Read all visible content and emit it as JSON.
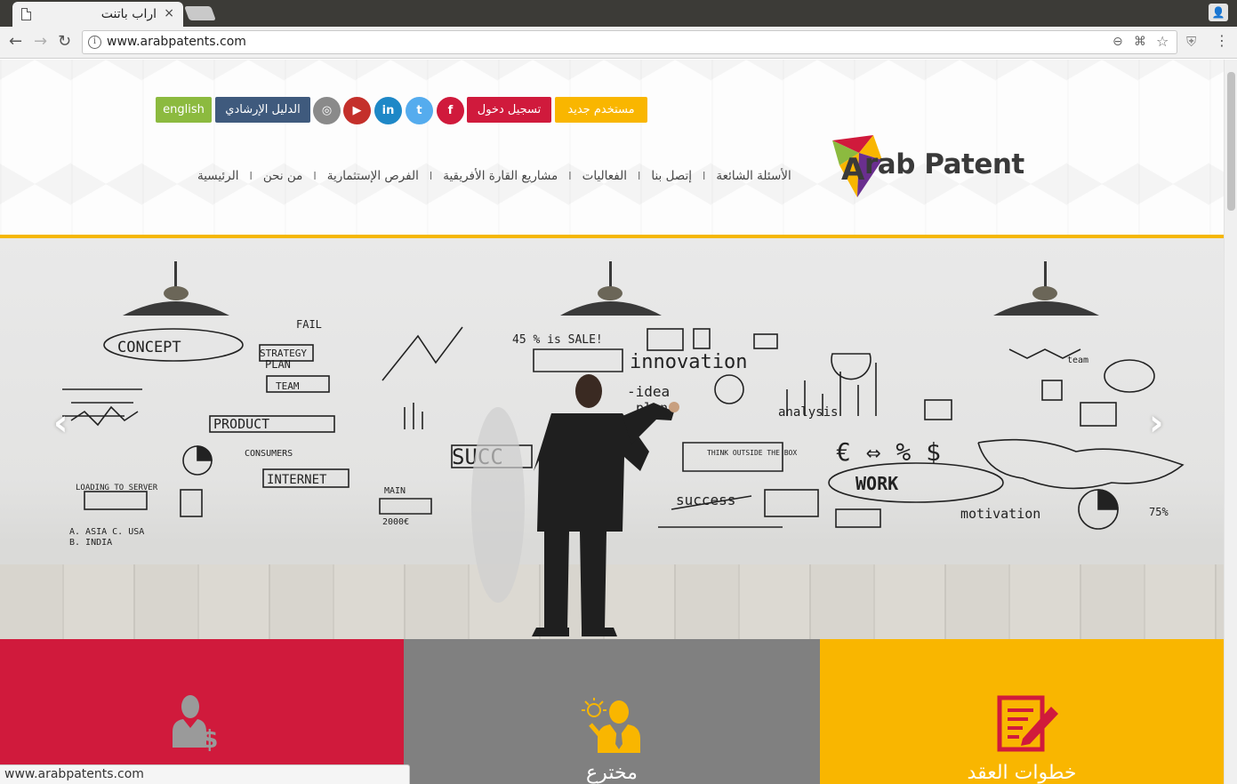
{
  "browser": {
    "tab_title": "اراب باتنت",
    "tab_close": "×",
    "url": "www.arabpatents.com",
    "status_url": "www.arabpatents.com"
  },
  "topbar": {
    "new_user": "مستخدم جديد",
    "login": "تسجيل دخول",
    "guide": "الدليل الإرشادي",
    "english": "english",
    "social": [
      "f",
      "t",
      "in",
      "yt",
      "ig"
    ]
  },
  "logo": {
    "text": "rab Patent"
  },
  "nav": {
    "items": [
      "الرئيسية",
      "من نحن",
      "الفرص الإستثمارية",
      "مشاريع القارة الأفريقية",
      "الفعاليات",
      "إتصل بنا",
      "الأسئلة الشائعة"
    ],
    "separator": "ا"
  },
  "slider": {
    "prev": "‹",
    "next": "›",
    "wall_words": {
      "concept": "CONCEPT",
      "fail": "FAIL",
      "strategy": "STRATEGY",
      "plan": "PLAN",
      "team": "TEAM",
      "sale": "45 % is SALE!",
      "innovation": "innovation",
      "idea": "-idea",
      "plan2": "plan",
      "product": "PRODUCT",
      "consumers": "CONSUMERS",
      "internet": "INTERNET",
      "success": "SUCC",
      "success2": "success",
      "think": "THINK OUTSIDE THE BOX",
      "analysis": "analysis",
      "work": "WORK",
      "motivation": "motivation",
      "percent": "75%",
      "symbols": "€ ⇔ % $",
      "loading": "LOADING TO SERVER",
      "asia": "A. ASIA     C. USA",
      "india": "B. INDIA",
      "team2": "team",
      "main": "MAIN",
      "year": "2000€"
    }
  },
  "tiles": [
    {
      "label": "",
      "color": "#d01a3c",
      "icon": "investor-dollar-icon"
    },
    {
      "label": "مخترع",
      "color": "#808080",
      "icon": "inventor-idea-icon"
    },
    {
      "label": "خطوات العقد",
      "color": "#f9b600",
      "icon": "contract-pen-icon"
    }
  ],
  "colors": {
    "new_user": "#f9b600",
    "login": "#d01a3c",
    "guide": "#3f5a7d",
    "english": "#8cba3f",
    "facebook": "#d01a3c",
    "twitter": "#55acee",
    "linkedin": "#1e88c7",
    "youtube": "#c4302b",
    "instagram": "#8a8a8a",
    "accent_rule": "#f5b700"
  }
}
